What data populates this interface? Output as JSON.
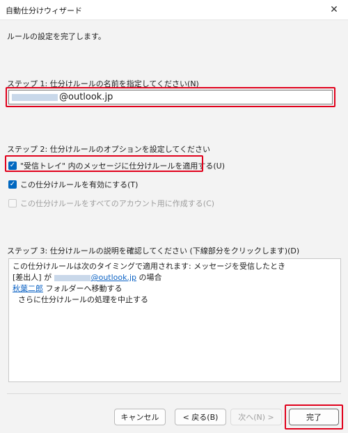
{
  "window": {
    "title": "自動仕分けウィザード",
    "close_glyph": "✕"
  },
  "intro": "ルールの設定を完了します。",
  "step1": {
    "label": "ステップ 1: 仕分けルールの名前を指定してください(N)",
    "value": "@outlook.jp"
  },
  "step2": {
    "label": "ステップ 2: 仕分けルールのオプションを設定してください",
    "options": [
      {
        "label": "\"受信トレイ\" 内のメッセージに仕分けルールを適用する(U)",
        "checked": true,
        "enabled": true
      },
      {
        "label": "この仕分けルールを有効にする(T)",
        "checked": true,
        "enabled": true
      },
      {
        "label": "この仕分けルールをすべてのアカウント用に作成する(C)",
        "checked": false,
        "enabled": false
      }
    ]
  },
  "step3": {
    "label": "ステップ 3: 仕分けルールの説明を確認してください (下線部分をクリックします)(D)",
    "line1": "この仕分けルールは次のタイミングで適用されます: メッセージを受信したとき",
    "line2_prefix": "[差出人] が",
    "line2_link": "@outlook.jp",
    "line2_suffix": "の場合",
    "line3_link": "秋葉二郎",
    "line3_suffix": "フォルダーへ移動する",
    "line4": "さらに仕分けルールの処理を中止する"
  },
  "buttons": {
    "cancel": "キャンセル",
    "back": "< 戻る(B)",
    "next": "次へ(N) >",
    "finish": "完了"
  },
  "colors": {
    "highlight": "#e0001b",
    "accent": "#0067c0",
    "link": "#0b62c4"
  },
  "icons": {
    "check": "✓"
  }
}
